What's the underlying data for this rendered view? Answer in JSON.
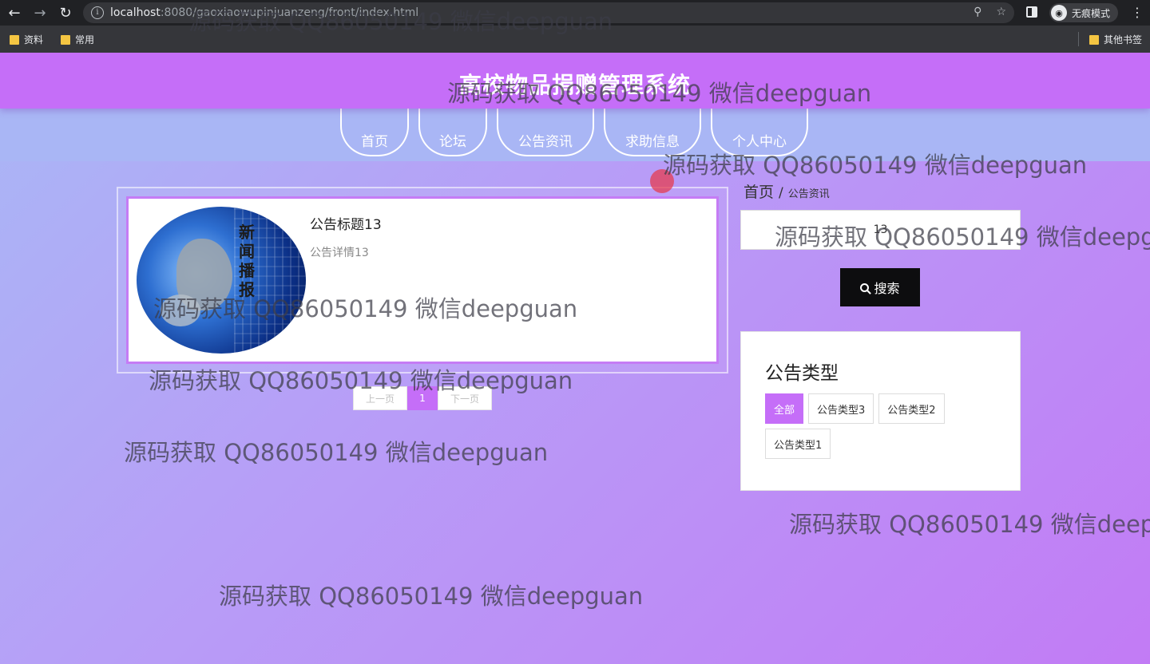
{
  "browser": {
    "url_host": "localhost",
    "url_rest": ":8080/gaoxiaowupinjuanzeng/front/index.html",
    "info_glyph": "i",
    "incognito_label": "无痕模式",
    "bookmarks": [
      "资料",
      "常用"
    ],
    "other_bookmarks": "其他书签",
    "icons": [
      "back-arrow-icon",
      "forward-arrow-icon",
      "reload-icon",
      "info-icon",
      "key-icon",
      "star-icon",
      "side-panel-icon",
      "incognito-icon",
      "menu-dots-icon",
      "folder-icon"
    ]
  },
  "site": {
    "title": "高校物品捐赠管理系统",
    "header_color": "#c56ef8",
    "nav": [
      "首页",
      "论坛",
      "公告资讯",
      "求助信息",
      "个人中心"
    ]
  },
  "notices": [
    {
      "title": "公告标题13",
      "detail": "公告详情13",
      "image_text": "新闻播报"
    }
  ],
  "pagination": {
    "prev": "上一页",
    "current": "1",
    "next": "下一页"
  },
  "breadcrumb": {
    "home": "首页",
    "separator": "/",
    "current": "公告资讯"
  },
  "search": {
    "value": "13",
    "button_label": "搜索"
  },
  "types": {
    "title": "公告类型",
    "items": [
      "全部",
      "公告类型3",
      "公告类型2",
      "公告类型1"
    ],
    "active": "全部"
  },
  "watermark": "源码获取 QQ86050149 微信deepguan"
}
